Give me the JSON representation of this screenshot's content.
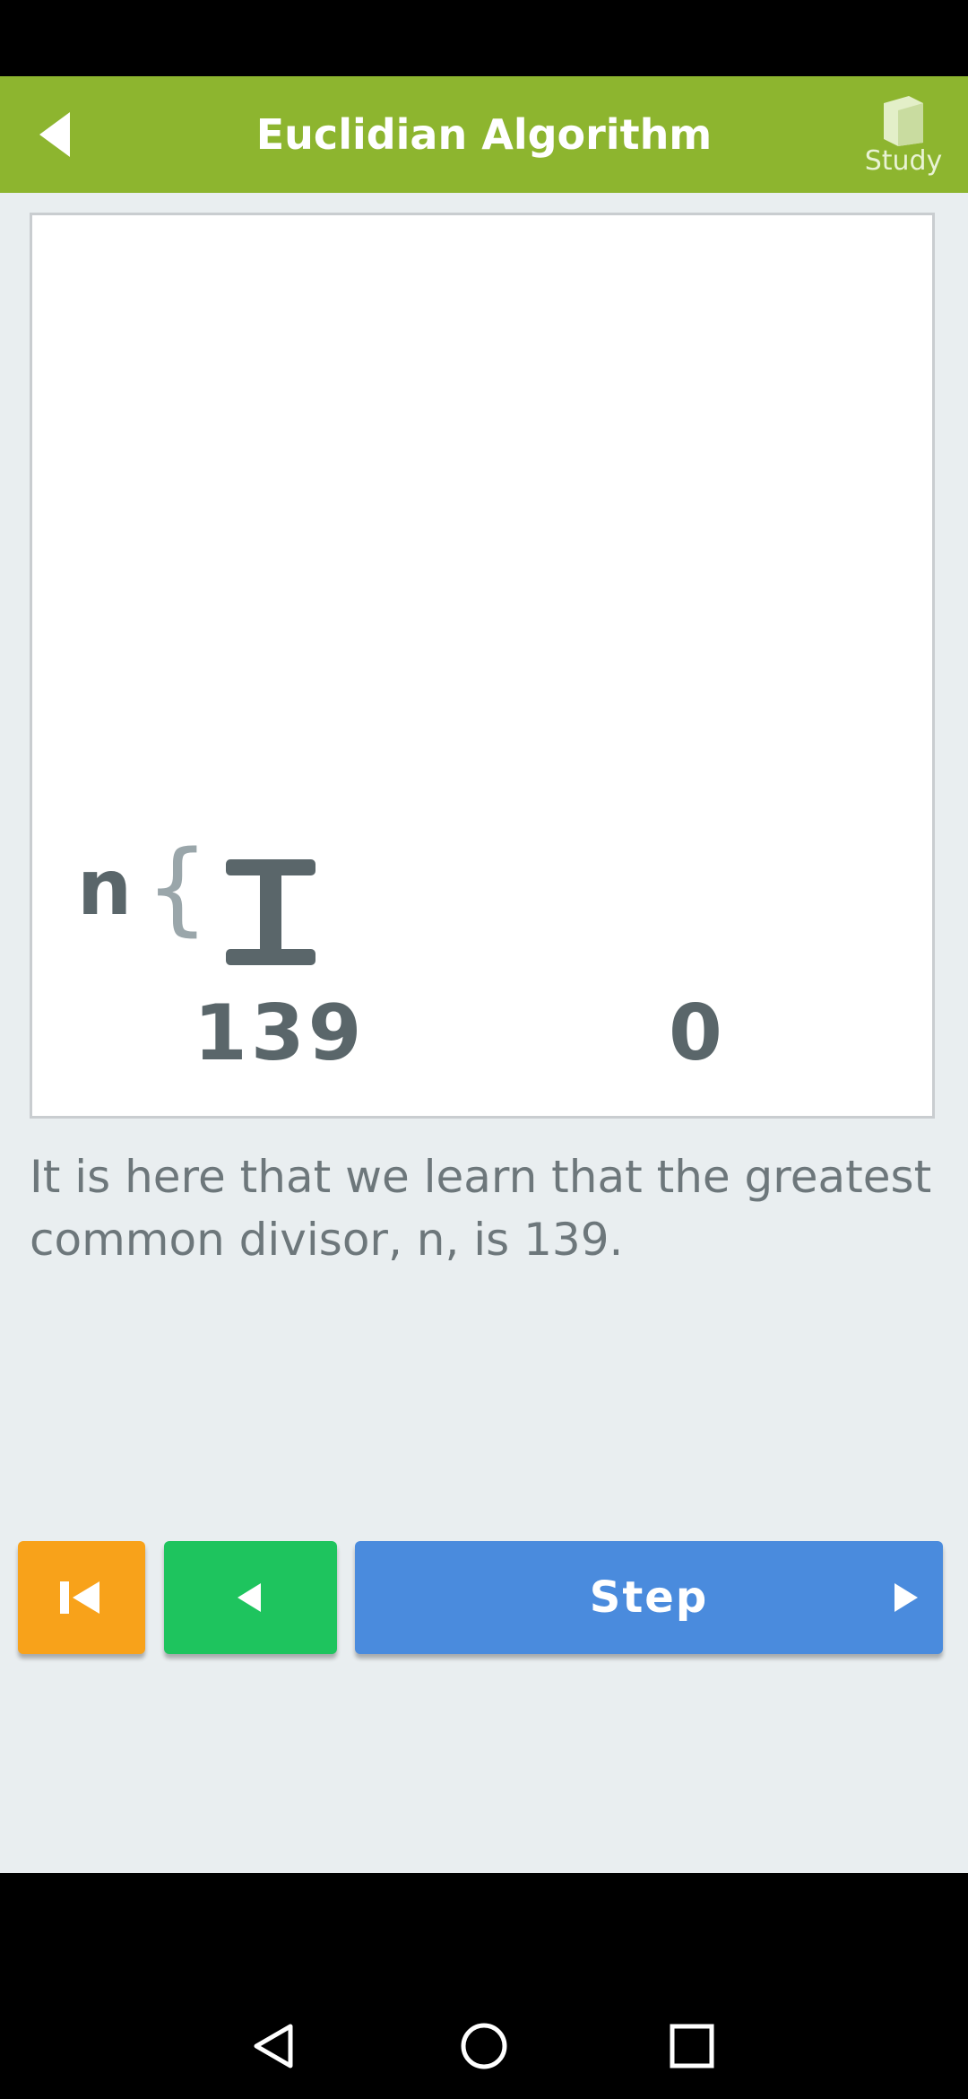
{
  "app_bar": {
    "title": "Euclidian Algorithm",
    "back_icon": "back-arrow-icon",
    "study_icon": "book-icon",
    "study_label": "Study",
    "color": "#8db52f"
  },
  "diagram": {
    "n_label": "n",
    "brace": "{",
    "left_value": "139",
    "right_value": "0"
  },
  "explanation": "It is here that we learn that the greatest common divisor, n, is 139.",
  "controls": {
    "rewind_icon": "rewind-icon",
    "previous_icon": "previous-icon",
    "step_label": "Step",
    "step_icon": "play-icon",
    "colors": {
      "rewind": "#f8a21a",
      "previous": "#1ec45e",
      "step": "#4a8bdd"
    }
  },
  "system_nav": {
    "back": "nav-back-icon",
    "home": "nav-home-icon",
    "recents": "nav-recents-icon"
  }
}
